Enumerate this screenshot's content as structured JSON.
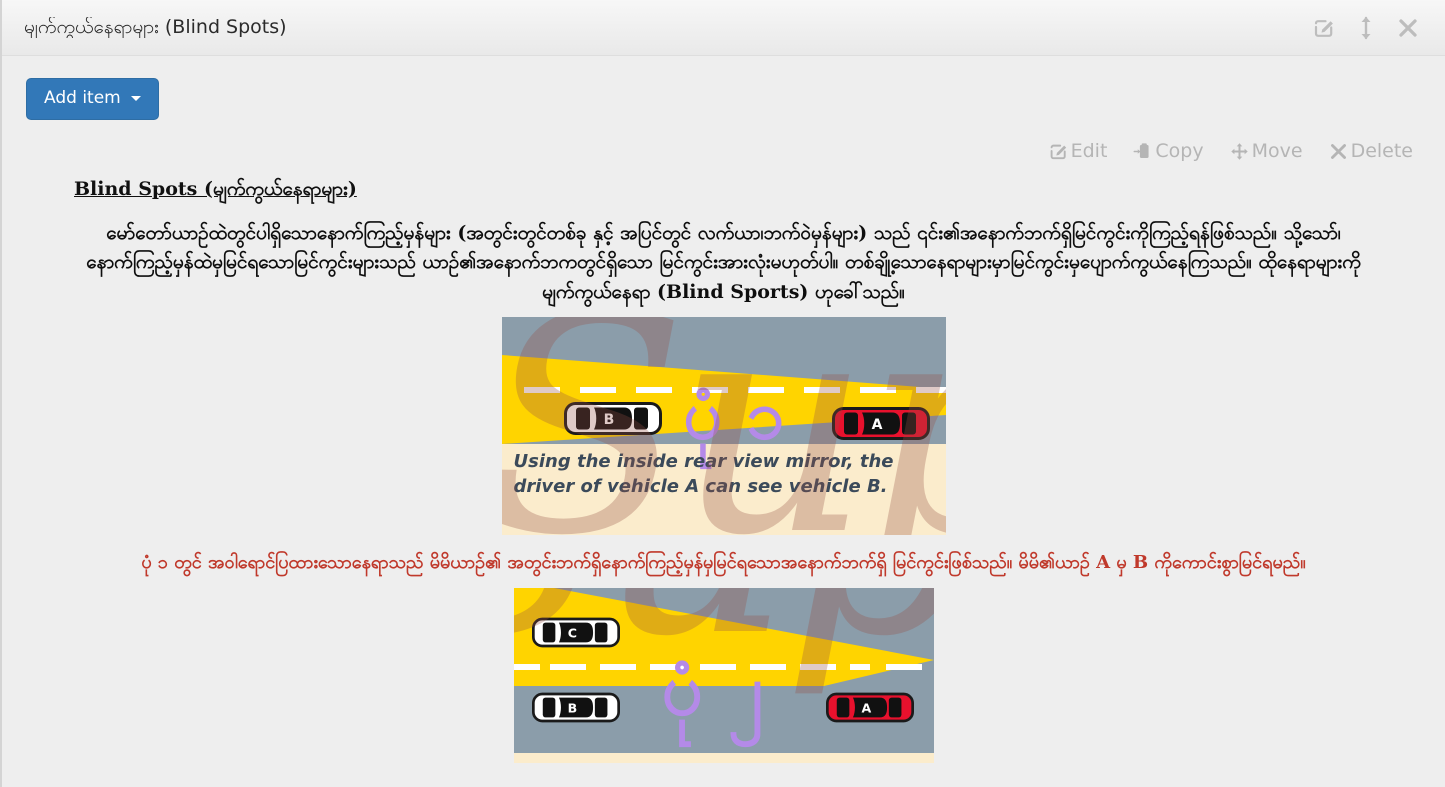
{
  "window": {
    "title": "မျက်ကွယ်နေရာများ (Blind Spots)",
    "icons": [
      {
        "name": "edit-icon",
        "label": "Edit"
      },
      {
        "name": "resize-vertical-icon",
        "label": "Resize"
      },
      {
        "name": "close-icon",
        "label": "Close"
      }
    ]
  },
  "toolbar": {
    "add_item_label": "Add item"
  },
  "actions": [
    {
      "name": "edit-action",
      "label": "Edit",
      "icon": "edit-square-icon"
    },
    {
      "name": "copy-action",
      "label": "Copy",
      "icon": "copy-icon"
    },
    {
      "name": "move-action",
      "label": "Move",
      "icon": "move-arrows-icon"
    },
    {
      "name": "delete-action",
      "label": "Delete",
      "icon": "close-x-icon"
    }
  ],
  "document": {
    "heading": "Blind Spots (မျက်ကွယ်နေရာများ)",
    "paragraph": "မော်တော်ယာဉ်ထဲတွင်ပါရှိသောနောက်ကြည့်မှန်များ (အတွင်းတွင်တစ်ခု နှင့် အပြင်တွင် လက်ယာ၊ဘက်ဝဲမှန်များ) သည် ၎င်း၏အနောက်ဘက်ရှိမြင်ကွင်းကိုကြည့်ရန်ဖြစ်သည်။ သို့သော်၊ နောက်ကြည့်မှန်ထဲမှမြင်ရသောမြင်ကွင်းများသည် ယာဉ်၏အနောက်ဘကတွင်ရှိသော မြင်ကွင်းအားလုံးမဟုတ်ပါ။ တစ်ချို့သောနေရာများမှာမြင်ကွင်းမှပျောက်ကွယ်နေကြသည်။ ထိုနေရာများကို မျက်ကွယ်နေရာ (Blind Sports) ဟုခေါ်သည်။",
    "red_caption": "ပုံ ၁ တွင် အဝါရောင်ပြထားသောနေရာသည် မိမိယာဉ်၏ အတွင်းဘက်ရှိနောက်ကြည့်မှန်မှမြင်ရသောအနောက်ဘက်ရှိ မြင်ကွင်းဖြစ်သည်။ မိမိ၏ယာဉ် A မှ B ကိုကောင်းစွာမြင်ရမည်။"
  },
  "figure1": {
    "caption": "Using the inside rear view mirror, the driver of vehicle A can see vehicle B.",
    "overlay_label": "ပုံ ၁",
    "cars": [
      {
        "name": "car-b",
        "label": "B",
        "color": "#ffffff"
      },
      {
        "name": "car-a",
        "label": "A",
        "color": "#e8112d"
      }
    ],
    "colors": {
      "road": "#8b9daa",
      "cone": "#ffd400",
      "caption_bg": "#fbeccc",
      "lane_marking": "#ffffff",
      "overlay": "#b48ae8"
    }
  },
  "figure2": {
    "overlay_label": "ပုံ ၂",
    "cars": [
      {
        "name": "car-c",
        "label": "C",
        "color": "#ffffff"
      },
      {
        "name": "car-b",
        "label": "B",
        "color": "#ffffff"
      },
      {
        "name": "car-a",
        "label": "A",
        "color": "#e8112d"
      }
    ],
    "colors": {
      "road": "#8b9daa",
      "cone": "#ffd400",
      "lane_marking": "#ffffff",
      "overlay": "#b48ae8"
    }
  },
  "watermark": {
    "text": "Super"
  },
  "theme": {
    "background": "#eeeeee",
    "primary_button": "#3278b8",
    "action_text": "#b5b5b5",
    "red_text": "#c0392b"
  }
}
